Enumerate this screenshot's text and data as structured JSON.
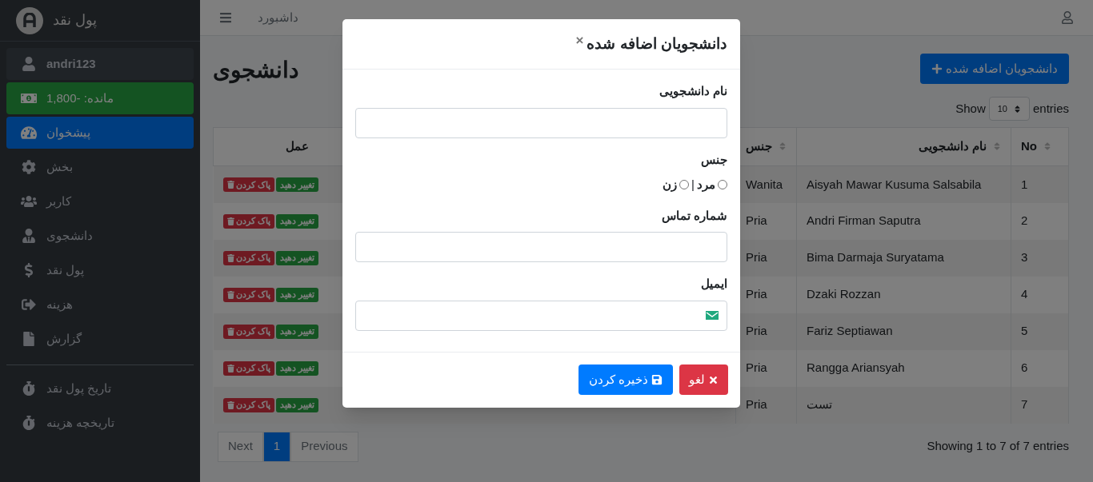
{
  "sidebar": {
    "brand": "پول نقد",
    "items": [
      {
        "kind": "user",
        "label": "andri123"
      },
      {
        "kind": "balance",
        "label": "مانده: -1,800"
      },
      {
        "kind": "link",
        "label": "پیشخوان",
        "selected": true
      },
      {
        "kind": "link",
        "label": "بخش",
        "selected": false
      },
      {
        "kind": "link",
        "label": "کاربر",
        "selected": false
      },
      {
        "kind": "link",
        "label": "دانشجوی",
        "selected": false
      },
      {
        "kind": "link",
        "label": "پول نقد",
        "selected": false
      },
      {
        "kind": "link",
        "label": "هزینه",
        "selected": false
      },
      {
        "kind": "link",
        "label": "گزارش",
        "selected": false
      }
    ],
    "history_items": [
      {
        "label": "تاریخ پول نقد",
        "selected": false
      },
      {
        "label": "تاریخچه هزینه",
        "selected": false
      }
    ]
  },
  "topbar": {
    "breadcrumb": "داشبورد"
  },
  "page": {
    "title": "دانشجوی",
    "add_button": "دانشجویان اضافه شده"
  },
  "table": {
    "length": {
      "show": "Show",
      "value": "10",
      "entries": "entries"
    },
    "columns": [
      "No",
      "نام دانشجویی",
      "جنس",
      "عمل"
    ],
    "rows": [
      {
        "no": "1",
        "name": "Aisyah Mawar Kusuma Salsabila",
        "gender": "Wanita",
        "edit": "تغییر دهید",
        "delete": "پاک کردن"
      },
      {
        "no": "2",
        "name": "Andri Firman Saputra",
        "gender": "Pria",
        "edit": "تغییر دهید",
        "delete": "پاک کردن"
      },
      {
        "no": "3",
        "name": "Bima Darmaja Suryatama",
        "gender": "Pria",
        "edit": "تغییر دهید",
        "delete": "پاک کردن"
      },
      {
        "no": "4",
        "name": "Dzaki Rozzan",
        "gender": "Pria",
        "edit": "تغییر دهید",
        "delete": "پاک کردن"
      },
      {
        "no": "5",
        "name": "Fariz Septiawan",
        "gender": "Pria",
        "edit": "تغییر دهید",
        "delete": "پاک کردن"
      },
      {
        "no": "6",
        "name": "Rangga Ariansyah",
        "gender": "Pria",
        "edit": "تغییر دهید",
        "delete": "پاک کردن"
      },
      {
        "no": "7",
        "name": "تست",
        "gender": "Pria",
        "edit": "تغییر دهید",
        "delete": "پاک کردن"
      }
    ],
    "info": "Showing 1 to 7 of 7 entries",
    "pagination": [
      {
        "label": "Previous",
        "selected": false
      },
      {
        "label": "1",
        "selected": true
      },
      {
        "label": "Next",
        "selected": false
      }
    ]
  },
  "modal": {
    "title": "دانشجویان اضافه شده",
    "close": "×",
    "fields": [
      {
        "kind": "text",
        "label": "نام دانشجویی"
      },
      {
        "kind": "radio",
        "label": "جنس",
        "separator": "|",
        "options": [
          {
            "label": "مرد",
            "selected": false
          },
          {
            "label": "زن",
            "selected": false
          }
        ]
      },
      {
        "kind": "text",
        "label": "شماره تماس"
      },
      {
        "kind": "email",
        "label": "ایمیل"
      }
    ],
    "buttons": [
      {
        "kind": "cancel",
        "label": "لغو"
      },
      {
        "kind": "save",
        "label": "ذخیره کردن"
      }
    ]
  }
}
